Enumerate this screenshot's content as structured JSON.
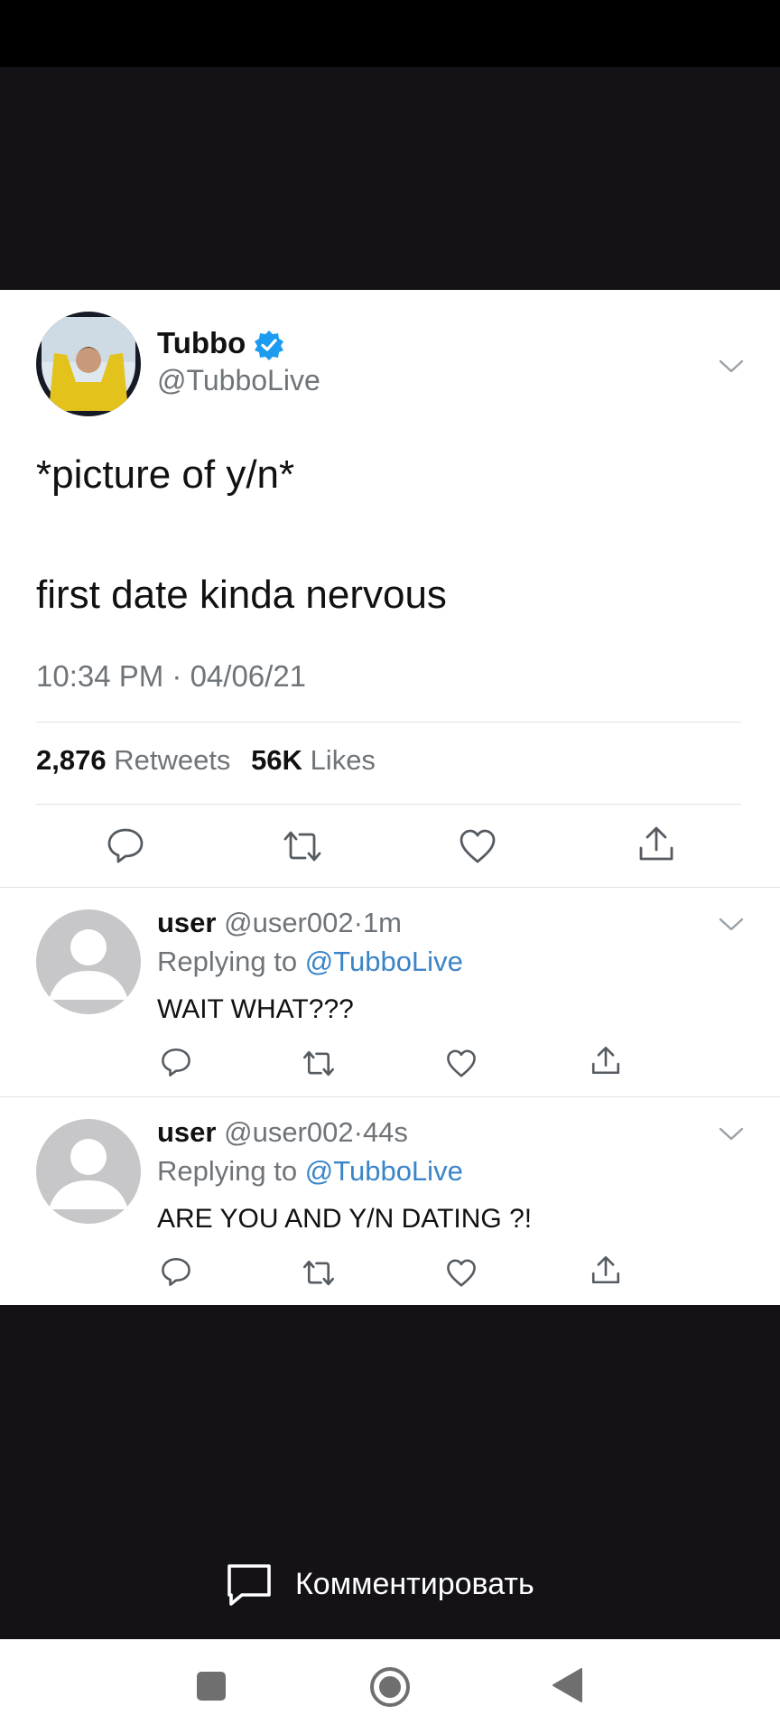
{
  "tweet": {
    "display_name": "Tubbo",
    "handle": "@TubboLive",
    "text_line1": "*picture of y/n*",
    "text_line2": "first date kinda nervous",
    "timestamp": "10:34 PM · 04/06/21",
    "retweets_count": "2,876",
    "retweets_label": "Retweets",
    "likes_count": "56K",
    "likes_label": "Likes"
  },
  "replies": [
    {
      "name": "user",
      "handle": "@user002",
      "time": "1m",
      "replying_prefix": "Replying to",
      "replying_to": "@TubboLive",
      "text": "WAIT WHAT???"
    },
    {
      "name": "user",
      "handle": "@user002",
      "time": "44s",
      "replying_prefix": "Replying to",
      "replying_to": "@TubboLive",
      "text": "ARE YOU AND Y/N DATING ?!"
    }
  ],
  "comment_button": {
    "label": "Комментировать"
  },
  "colors": {
    "mention": "#3a85c8",
    "verified": "#1d9bf0",
    "viewer_bg": "#151217"
  }
}
